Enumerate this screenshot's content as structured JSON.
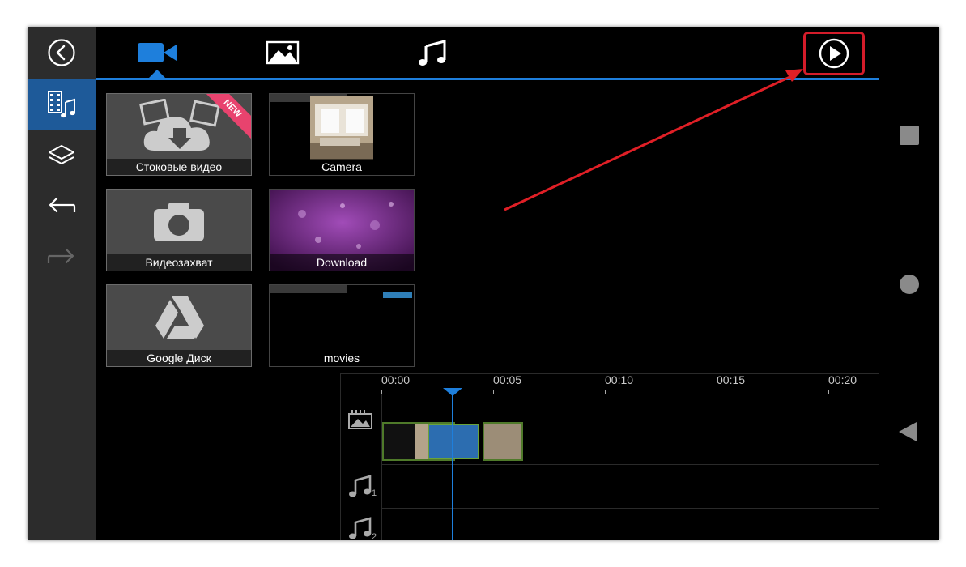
{
  "tabs": [
    {
      "id": "video",
      "icon": "video-camera-icon",
      "active": true
    },
    {
      "id": "image",
      "icon": "image-icon",
      "active": false
    },
    {
      "id": "music",
      "icon": "music-note-icon",
      "active": false
    }
  ],
  "tiles": [
    {
      "label": "Стоковые видео",
      "badge": "NEW"
    },
    {
      "label": "Camera"
    },
    {
      "label": "Видеозахват"
    },
    {
      "label": "Download"
    },
    {
      "label": "Google Диск"
    },
    {
      "label": "movies"
    }
  ],
  "timeline": {
    "ticks": [
      "00:00",
      "00:05",
      "00:10",
      "00:15",
      "00:20"
    ],
    "audio_tracks": [
      "1",
      "2"
    ]
  },
  "colors": {
    "accent": "#1e7fdc",
    "highlight": "#d41c2a",
    "new_badge": "#e8436e",
    "sidebar_active": "#1e5a99"
  }
}
